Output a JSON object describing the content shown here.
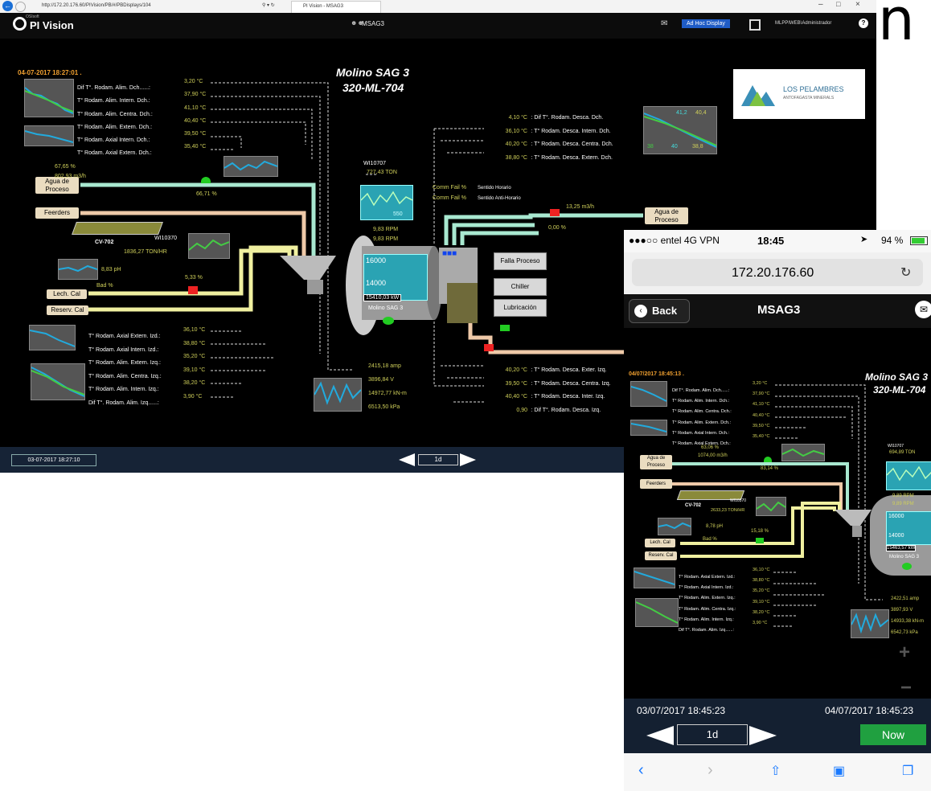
{
  "browser": {
    "url": "http://172.20.176.60/PIVision/PB/#/PBDisplays/104",
    "tab": "PI Vision - MSAG3"
  },
  "header": {
    "brand_small": "OSIsoft",
    "brand": "PI Vision",
    "display": "MSAG3",
    "adhoc": "Ad Hoc Display",
    "user": "MLPPIWEB\\Administrador",
    "help": "?"
  },
  "display": {
    "timestamp": "04-07-2017 18:27:01 .",
    "title1": "Molino SAG 3",
    "title2": "320-ML-704",
    "logo_name": "LOS PELAMBRES",
    "logo_sub": "ANTOFAGASTA MINERALS",
    "left_top": [
      {
        "label": "Dif T°. Rodam. Alim. Dch......:",
        "value": "3,20 °C"
      },
      {
        "label": "T° Rodam. Alim. Intern. Dch.:",
        "value": "37,90 °C"
      },
      {
        "label": "T° Rodam. Alim. Centra. Dch.:",
        "value": "41,10 °C"
      },
      {
        "label": "T° Rodam. Alim. Extern. Dch.:",
        "value": "40,40 °C"
      },
      {
        "label": "T° Rodam. Axial Intern. Dch.:",
        "value": "39,50 °C"
      },
      {
        "label": "T° Rodam. Axial Extern. Dch.:",
        "value": "35,40 °C"
      }
    ],
    "left_bot": [
      {
        "label": "T° Rodam. Axial Extern. Izd.:",
        "value": "36,10 °C"
      },
      {
        "label": "T° Rodam. Axial Intern. Izd.:",
        "value": "38,80 °C"
      },
      {
        "label": "T° Rodam. Alim. Extern. Izq.:",
        "value": "35,20 °C"
      },
      {
        "label": "T° Rodam. Alim. Centra. Izq.:",
        "value": "39,10 °C"
      },
      {
        "label": "T° Rodam. Alim. Intern. Izq.:",
        "value": "38,20 °C"
      },
      {
        "label": "Dif T°. Rodam. Alim. Izq......:",
        "value": "3,90 °C"
      }
    ],
    "right_top": [
      {
        "value": "4,10 °C",
        "label": ": Dif T°. Rodam. Desca. Dch."
      },
      {
        "value": "36,10 °C",
        "label": ": T° Rodam. Desca. Intern. Dch."
      },
      {
        "value": "40,20 °C",
        "label": ": T° Rodam. Desca. Centra. Dch."
      },
      {
        "value": "38,80 °C",
        "label": ": T° Rodam. Desca. Extern. Dch."
      }
    ],
    "right_bot": [
      {
        "value": "40,20 °C",
        "label": ": T° Rodam. Desca. Exter. Izq."
      },
      {
        "value": "39,50 °C",
        "label": ": T° Rodam. Desca. Centra. Izq."
      },
      {
        "value": "40,40 °C",
        "label": ": T° Rodam. Desca. Inter. Izq."
      },
      {
        "value": "0,90",
        "label": ": Dif T°. Rodam. Desca. Izq."
      }
    ],
    "trend_vals": [
      "41,2",
      "40,4",
      "38",
      "40",
      "38,8"
    ],
    "agua": "Agua de Proceso",
    "feerders": "Feerders",
    "lech": "Lech. Cal",
    "reserv": "Reserv. Cal",
    "agua_pct": "67,65 %",
    "agua_flow": "802,93 m3/h",
    "valve1": "66,71 %",
    "cv": "CV-702",
    "wi10370": "WI10370",
    "ton_hr": "1836,27 TON/HR",
    "ph": "8,83 pH",
    "bad": "Bad %",
    "valve2": "5,33 %",
    "wi10707": "WI10707",
    "ton": "727,43 TON",
    "tank_val": "550",
    "rpm1": "9,83 RPM",
    "rpm2": "9,83 RPM",
    "val16000": "16000",
    "val14000": "14000",
    "kw": "15410,03 kW",
    "mill": "Molino SAG 3",
    "comm1": "Comm Fail %",
    "dir1": "Sentido Horario",
    "comm2": "Comm Fail %",
    "dir2": "Sentido Anti-Horario",
    "water_right": "13,25 m3/h",
    "valve3": "0,00 %",
    "agua2": "Agua de Proceso",
    "falla": "Falla Proceso",
    "chiller": "Chiller",
    "lub": "Lubricación",
    "amp": "2415,18 amp",
    "volt": "3896,84 V",
    "knm": "14972,77 kN-m",
    "kpa": "6513,50 kPa"
  },
  "footer": {
    "date": "03-07-2017 18:27:10",
    "range": "1d"
  },
  "phone": {
    "carrier": "●●●○○ entel  4G VPN",
    "time": "18:45",
    "battery": "94 %",
    "url": "172.20.176.60",
    "back": "Back",
    "title": "MSAG3",
    "timestamp": "04/07/2017 18:45:13 .",
    "title1": "Molino SAG 3",
    "title2": "320-ML-704",
    "top_rows": [
      {
        "label": "Dif T°. Rodam. Alim. Dch......:",
        "value": "3,20 °C"
      },
      {
        "label": "T° Rodam. Alim. Intern. Dch.:",
        "value": "37,90 °C"
      },
      {
        "label": "T° Rodam. Alim. Centra. Dch.:",
        "value": "41,10 °C"
      },
      {
        "label": "T° Rodam. Alim. Extern. Dch.:",
        "value": "40,40 °C"
      },
      {
        "label": "T° Rodam. Axial Intern. Dch.:",
        "value": "39,50 °C"
      },
      {
        "label": "T° Rodam. Axial Extern. Dch.:",
        "value": "35,40 °C"
      }
    ],
    "bot_rows": [
      {
        "label": "T° Rodam. Axial Extern. Izd.:",
        "value": "36,10 °C"
      },
      {
        "label": "T° Rodam. Axial Intern. Izd.:",
        "value": "38,80 °C"
      },
      {
        "label": "T° Rodam. Alim. Extern. Izq.:",
        "value": "35,20 °C"
      },
      {
        "label": "T° Rodam. Alim. Centra. Izq.:",
        "value": "39,10 °C"
      },
      {
        "label": "T° Rodam. Alim. Intern. Izq.:",
        "value": "38,20 °C"
      },
      {
        "label": "Dif T°. Rodam. Alim. Izq......:",
        "value": "3,90 °C"
      }
    ],
    "pct": "63,06 %",
    "flow": "1074,00 m3/h",
    "valve": "83,14 %",
    "wi": "WI10707",
    "ton": "694,89 TON",
    "agua": "Agua de Proceso",
    "feerders": "Feerders",
    "cv": "CV-702",
    "wi2": "WI10370",
    "tonhr": "2633,23 TON/HR",
    "ph": "8,78 pH",
    "bad": "Bad %",
    "valve2": "15,18 %",
    "lech": "Lech. Cal",
    "reserv": "Reserv. Cal",
    "rpm1": "9,89 RPM",
    "rpm2": "9,89 RPM",
    "v16": "16000",
    "v14": "14000",
    "kw": "15463,57 kW",
    "mill": "Molino SAG 3",
    "amp": "2422,51 amp",
    "volt": "3897,93 V",
    "knm": "14933,38 kN-m",
    "kpa": "6542,73 kPa",
    "plus": "+",
    "minus": "−",
    "start": "03/07/2017 18:45:23",
    "end": "04/07/2017 18:45:23",
    "range": "1d",
    "now": "Now"
  },
  "corner_glyph": "n",
  "colors": {
    "bg": "#000000",
    "value": "#cfcf5a",
    "tank": "#2aa3b3",
    "now": "#20a040",
    "pipe_water": "#a8e8d0",
    "pipe_lime": "#f0f0a0"
  }
}
